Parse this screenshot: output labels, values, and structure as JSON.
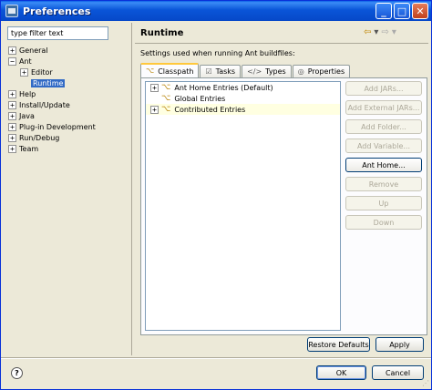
{
  "window": {
    "title": "Preferences"
  },
  "filter": {
    "placeholder": "type filter text"
  },
  "tree": [
    {
      "label": "General",
      "expander": "+"
    },
    {
      "label": "Ant",
      "expander": "−"
    },
    {
      "label": "Editor",
      "expander": "+"
    },
    {
      "label": "Runtime",
      "expander": ""
    },
    {
      "label": "Help",
      "expander": "+"
    },
    {
      "label": "Install/Update",
      "expander": "+"
    },
    {
      "label": "Java",
      "expander": "+"
    },
    {
      "label": "Plug-in Development",
      "expander": "+"
    },
    {
      "label": "Run/Debug",
      "expander": "+"
    },
    {
      "label": "Team",
      "expander": "+"
    }
  ],
  "page": {
    "title": "Runtime",
    "description": "Settings used when running Ant buildfiles:"
  },
  "tabs": [
    "Classpath",
    "Tasks",
    "Types",
    "Properties"
  ],
  "classpath": {
    "entries": [
      {
        "label": "Ant Home Entries (Default)",
        "expander": "+"
      },
      {
        "label": "Global Entries",
        "expander": ""
      },
      {
        "label": "Contributed Entries",
        "expander": "+"
      }
    ],
    "buttons": [
      "Add JARs...",
      "Add External JARs...",
      "Add Folder...",
      "Add Variable...",
      "Ant Home...",
      "Remove",
      "Up",
      "Down"
    ]
  },
  "actions": {
    "restore_defaults": "Restore Defaults",
    "apply": "Apply"
  },
  "footer": {
    "ok": "OK",
    "cancel": "Cancel",
    "help": "?"
  },
  "colors": {
    "title_bar": "#0a55d8",
    "selection": "#316ac5",
    "tab_highlight": "#ffc83c",
    "row_highlight": "#ffffe1"
  }
}
